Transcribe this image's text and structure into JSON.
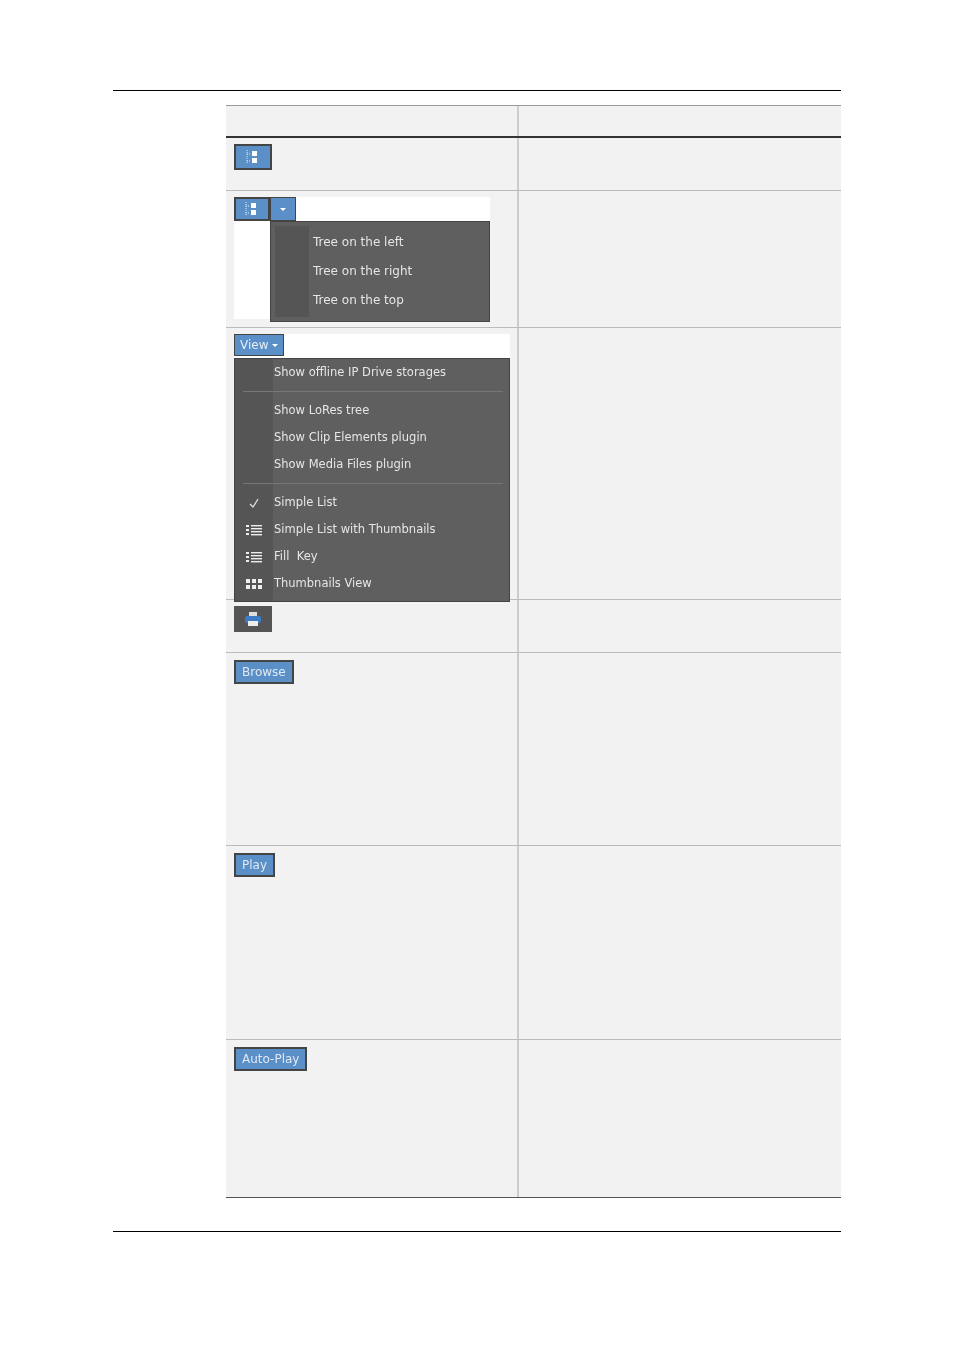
{
  "table": {
    "rows": [
      {
        "kind": "tree_button"
      },
      {
        "kind": "tree_dropdown",
        "menu": [
          "Tree on the left",
          "Tree on the right",
          "Tree on the top"
        ]
      },
      {
        "kind": "view_menu",
        "label": "View",
        "sections": [
          [
            {
              "label": "Show offline IP Drive storages",
              "kind": "plain"
            }
          ],
          [
            {
              "label": "Show LoRes tree",
              "kind": "plain"
            },
            {
              "label": "Show Clip Elements plugin",
              "kind": "plain"
            },
            {
              "label": "Show Media Files plugin",
              "kind": "plain"
            }
          ],
          [
            {
              "label": "Simple List",
              "kind": "check"
            },
            {
              "label": "Simple List with Thumbnails",
              "kind": "list"
            },
            {
              "label": "Fill  Key",
              "kind": "list"
            },
            {
              "label": "Thumbnails View",
              "kind": "grid"
            }
          ]
        ]
      },
      {
        "kind": "print_button"
      },
      {
        "kind": "text_button",
        "label": "Browse"
      },
      {
        "kind": "text_button",
        "label": "Play"
      },
      {
        "kind": "text_button",
        "label": "Auto-Play"
      }
    ]
  }
}
